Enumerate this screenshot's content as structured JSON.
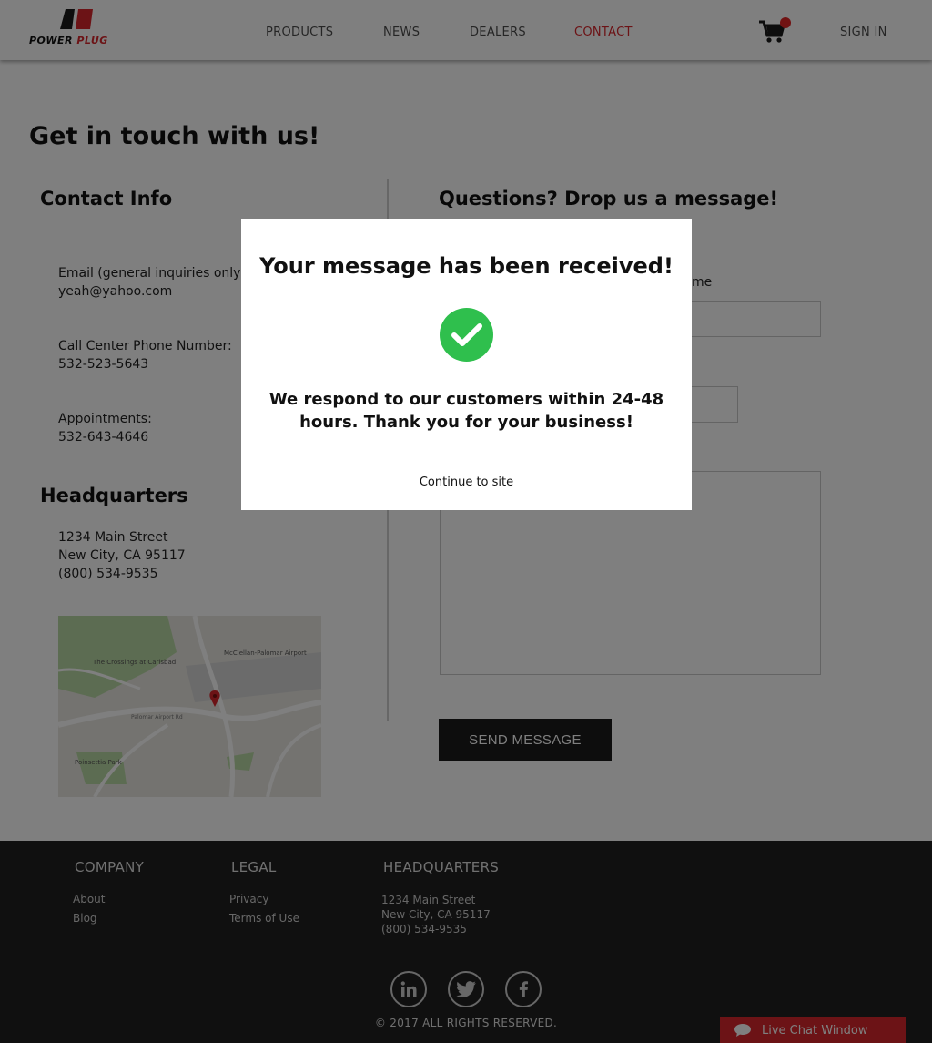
{
  "header": {
    "logo": {
      "word1": "POWER",
      "word2": "PLUG"
    },
    "nav": [
      {
        "label": "PRODUCTS"
      },
      {
        "label": "NEWS"
      },
      {
        "label": "DEALERS"
      },
      {
        "label": "CONTACT",
        "active": true
      }
    ],
    "sign_in": "SIGN IN",
    "accent_color": "#d9262c"
  },
  "main": {
    "title": "Get in touch with us!",
    "contact_info": {
      "heading": "Contact Info",
      "email_label": "Email (general inquiries only):",
      "email_value": "yeah@yahoo.com",
      "phone_label": "Call Center Phone Number:",
      "phone_value": "532-523-5643",
      "appointments_label": "Appointments:",
      "appointments_value": "532-643-4646"
    },
    "headquarters": {
      "heading": "Headquarters",
      "street": "1234 Main Street",
      "city": "New City, CA 95117",
      "phone": "(800) 534-9535"
    },
    "map": {
      "labels": [
        "The Crossings at Carlsbad",
        "McClellan-Palomar Airport",
        "Poinsettia Park",
        "Palomar Airport Rd"
      ]
    },
    "form": {
      "heading": "Questions? Drop us a message!",
      "name_label_fragment": "me",
      "send_button": "SEND MESSAGE"
    }
  },
  "footer": {
    "company": {
      "heading": "COMPANY",
      "links": [
        "About",
        "Blog"
      ]
    },
    "legal": {
      "heading": "LEGAL",
      "links": [
        "Privacy",
        "Terms of Use"
      ]
    },
    "headquarters": {
      "heading": "HEADQUARTERS",
      "street": "1234 Main Street",
      "city": "New City, CA 95117",
      "phone": "(800) 534-9535"
    },
    "social": [
      "linkedin-icon",
      "twitter-icon",
      "facebook-icon"
    ],
    "copyright": "© 2017 ALL RIGHTS RESERVED.",
    "live_chat": "Live Chat Window"
  },
  "modal": {
    "title": "Your message has been received!",
    "message": "We respond to our customers within 24-48 hours. Thank you for your business!",
    "continue_link": "Continue to site",
    "check_color": "#2fbf4d"
  }
}
